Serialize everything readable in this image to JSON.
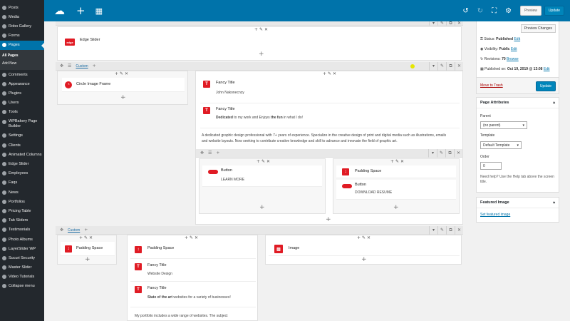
{
  "sidebar": {
    "items": [
      {
        "label": "Posts"
      },
      {
        "label": "Media"
      },
      {
        "label": "Robo Gallery"
      },
      {
        "label": "Forms"
      },
      {
        "label": "Pages"
      }
    ],
    "pages_sub": [
      "All Pages",
      "Add New"
    ],
    "items2": [
      {
        "label": "Comments"
      },
      {
        "label": "Appearance"
      },
      {
        "label": "Plugins"
      },
      {
        "label": "Users"
      },
      {
        "label": "Tools"
      }
    ],
    "wpbakery": "WPBakery Page Builder",
    "items3": [
      {
        "label": "Settings"
      },
      {
        "label": "Clients"
      },
      {
        "label": "Animated Columns"
      },
      {
        "label": "Edge Slider"
      },
      {
        "label": "Employees"
      },
      {
        "label": "Faqs"
      },
      {
        "label": "News"
      },
      {
        "label": "Portfolios"
      },
      {
        "label": "Pricing Table"
      },
      {
        "label": "Tab Sliders"
      },
      {
        "label": "Testimonials"
      },
      {
        "label": "Photo Albums"
      },
      {
        "label": "LayerSlider WP"
      },
      {
        "label": "Sucuri Security"
      },
      {
        "label": "Master Slider"
      },
      {
        "label": "Video Tutorials"
      },
      {
        "label": "Collapse menu"
      }
    ]
  },
  "topbar": {
    "preview": "Preview",
    "update": "Update"
  },
  "canvas": {
    "edge_slider": "Edge Slider",
    "edge_icon": "edge",
    "custom": "Custom",
    "circle_image": "Circle Image Frame",
    "fancy_title": "Fancy Title",
    "john": "John Nakonecnzy",
    "dedicated_b1": "Dedicated",
    "dedicated_t1": " to my work and Enjoys ",
    "dedicated_b2": "the fun",
    "dedicated_t2": " in what I do!",
    "paragraph": "A dedicated graphic design professional with 7+ years of experience. Specialize in the creative design of print and digital media such as illustrations, emails and website layouts. Now seeking to contribute creative knowledge and skill to advance and innovate the field of graphic art.",
    "button": "Button",
    "learn_more": "LEARN MORE",
    "padding_space": "Padding Space",
    "download": "DOWNLOAD RESUME",
    "custom2": "Custom",
    "website_design": "Website Design",
    "state_b": "State of the art",
    "state_t": " websites for a variety of businesses!",
    "portfolio_text": "My portfolio includes a wide range of websites. The subject",
    "image": "Image",
    "icon_letter": "T"
  },
  "right": {
    "preview_changes": "Preview Changes",
    "status_label": "Status:",
    "status_value": "Published",
    "edit": "Edit",
    "visibility_label": "Visibility:",
    "visibility_value": "Public",
    "revisions_label": "Revisions:",
    "revisions_value": "70",
    "browse": "Browse",
    "published_label": "Published on:",
    "published_value": "Oct 19, 2019 @ 13:08",
    "trash": "Move to Trash",
    "update": "Update",
    "attrs_title": "Page Attributes",
    "parent_label": "Parent",
    "parent_value": "(no parent)",
    "template_label": "Template",
    "template_value": "Default Template",
    "order_label": "Order",
    "order_value": "0",
    "help": "Need help? Use the Help tab above the screen title.",
    "featured_title": "Featured Image",
    "featured_link": "Set featured image"
  }
}
